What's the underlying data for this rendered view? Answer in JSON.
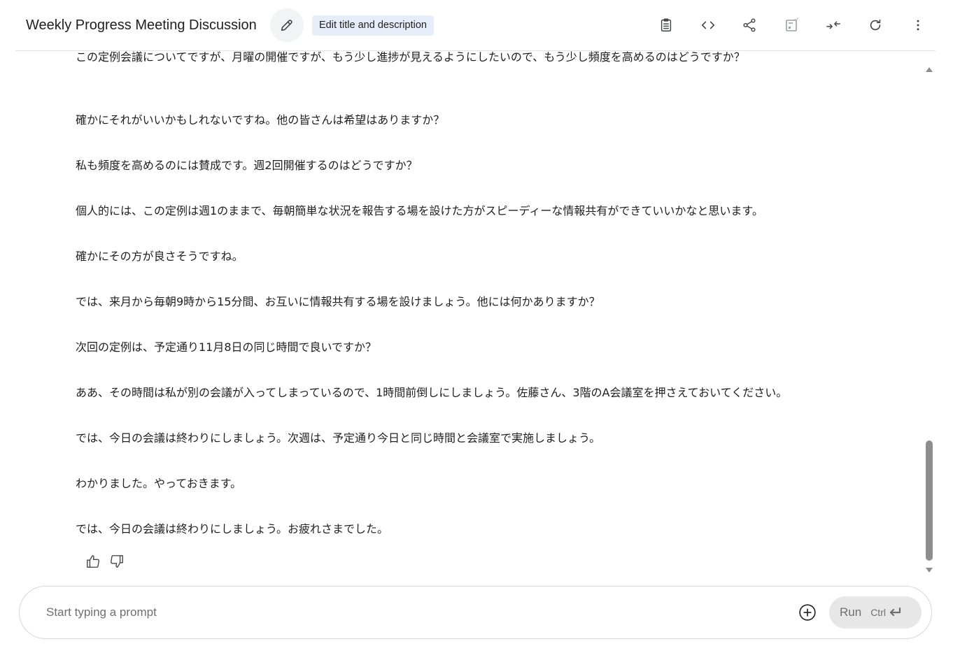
{
  "header": {
    "title": "Weekly Progress Meeting Discussion",
    "edit_tooltip": "Edit title and description",
    "icons": [
      "pencil-icon",
      "clipboard-icon",
      "code-icon",
      "share-icon",
      "compare-icon",
      "collapse-icon",
      "refresh-icon",
      "more-vert-icon"
    ]
  },
  "messages": [
    "この定例会議についてですが、月曜の開催ですが、もう少し進捗が見えるようにしたいので、もう少し頻度を高めるのはどうですか？",
    "確かにそれがいいかもしれないですね。他の皆さんは希望はありますか？",
    "私も頻度を高めるのには賛成です。週2回開催するのはどうですか？",
    "個人的には、この定例は週1のままで、毎朝簡単な状況を報告する場を設けた方がスピーディーな情報共有ができていいかなと思います。",
    "確かにその方が良さそうですね。",
    "では、来月から毎朝9時から15分間、お互いに情報共有する場を設けましょう。他には何かありますか？",
    "次回の定例は、予定通り11月8日の同じ時間で良いですか？",
    "ああ、その時間は私が別の会議が入ってしまっているので、1時間前倒しにしましょう。佐藤さん、3階のA会議室を押さえておいてください。",
    "では、今日の会議は終わりにしましょう。次週は、予定通り今日と同じ時間と会議室で実施しましょう。",
    "わかりました。やっておきます。",
    "では、今日の会議は終わりにしましょう。お疲れさまでした。"
  ],
  "feedback": {
    "icons": [
      "thumbs-up-icon",
      "thumbs-down-icon"
    ]
  },
  "prompt": {
    "placeholder": "Start typing a prompt",
    "value": "",
    "run_label": "Run",
    "shortcut_label": "Ctrl"
  },
  "colors": {
    "tooltip_bg": "#e8eef9",
    "run_bg": "#e7e7e7",
    "scroll_thumb": "#8e8e8e",
    "icon": "#444746"
  }
}
